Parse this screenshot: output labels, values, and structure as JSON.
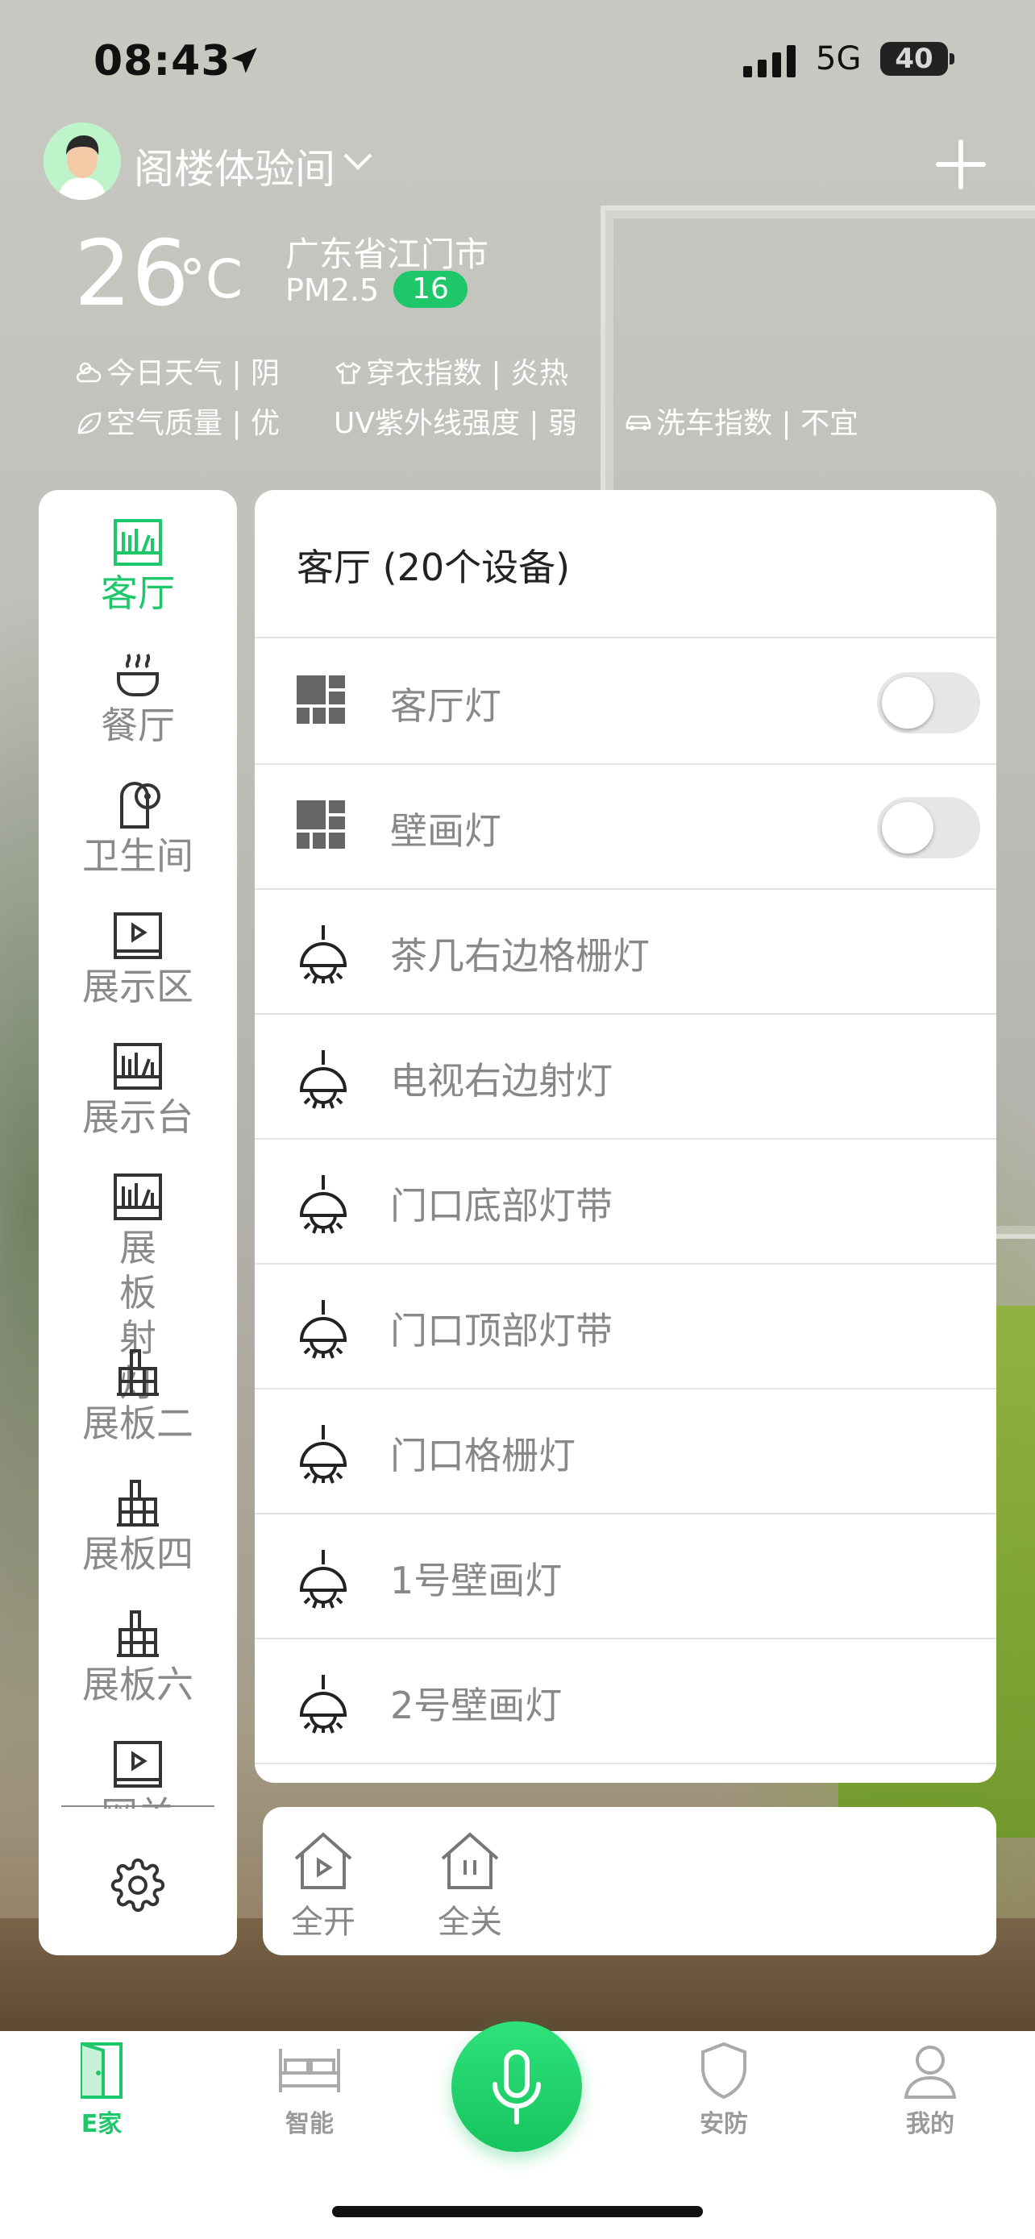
{
  "status_bar": {
    "time": "08:43",
    "network": "5G",
    "battery": "40"
  },
  "header": {
    "home_name": "阁楼体验间",
    "temperature": "26",
    "temperature_unit": "°C",
    "city": "广东省江门市",
    "pm_label": "PM2.5",
    "pm_value": "16",
    "weather_items": [
      {
        "icon": "cloud-sun-icon",
        "text": "今日天气 | 阴"
      },
      {
        "icon": "shirt-icon",
        "text": "穿衣指数 | 炎热"
      },
      {
        "icon": "leaf-icon",
        "text": "空气质量 | 优"
      },
      {
        "icon": "uv-icon",
        "text": "UV紫外线强度 | 弱"
      },
      {
        "icon": "car-icon",
        "text": "洗车指数 | 不宜"
      }
    ]
  },
  "rooms": [
    {
      "label": "客厅",
      "icon": "bookshelf-icon",
      "active": true
    },
    {
      "label": "餐厅",
      "icon": "hotpot-icon"
    },
    {
      "label": "卫生间",
      "icon": "toilet-paper-icon"
    },
    {
      "label": "展示区",
      "icon": "play-screen-icon"
    },
    {
      "label": "展示台",
      "icon": "bookshelf-icon"
    },
    {
      "label": "展板射灯",
      "icon": "bookshelf-icon"
    },
    {
      "label": "展板二",
      "icon": "cabinet-icon"
    },
    {
      "label": "展板四",
      "icon": "cabinet-icon"
    },
    {
      "label": "展板六",
      "icon": "cabinet-icon"
    },
    {
      "label": "网关",
      "icon": "play-screen-icon"
    }
  ],
  "panel": {
    "title": "客厅 (20个设备)",
    "devices": [
      {
        "label": "客厅灯",
        "icon": "switch-grid-icon",
        "toggle": false
      },
      {
        "label": "壁画灯",
        "icon": "switch-grid-icon",
        "toggle": false
      },
      {
        "label": "茶几右边格栅灯",
        "icon": "pendant-lamp-icon"
      },
      {
        "label": "电视右边射灯",
        "icon": "pendant-lamp-icon"
      },
      {
        "label": "门口底部灯带",
        "icon": "pendant-lamp-icon"
      },
      {
        "label": "门口顶部灯带",
        "icon": "pendant-lamp-icon"
      },
      {
        "label": "门口格栅灯",
        "icon": "pendant-lamp-icon"
      },
      {
        "label": "1号壁画灯",
        "icon": "pendant-lamp-icon"
      },
      {
        "label": "2号壁画灯",
        "icon": "pendant-lamp-icon"
      }
    ]
  },
  "actions": {
    "all_on": "全开",
    "all_off": "全关"
  },
  "tabs": [
    {
      "label": "E家",
      "icon": "door-icon",
      "active": true
    },
    {
      "label": "智能",
      "icon": "bed-icon"
    },
    {
      "label": "安防",
      "icon": "shield-icon"
    },
    {
      "label": "我的",
      "icon": "user-icon"
    }
  ],
  "colors": {
    "accent": "#1ec76a",
    "inactive": "#9a9a9a"
  }
}
